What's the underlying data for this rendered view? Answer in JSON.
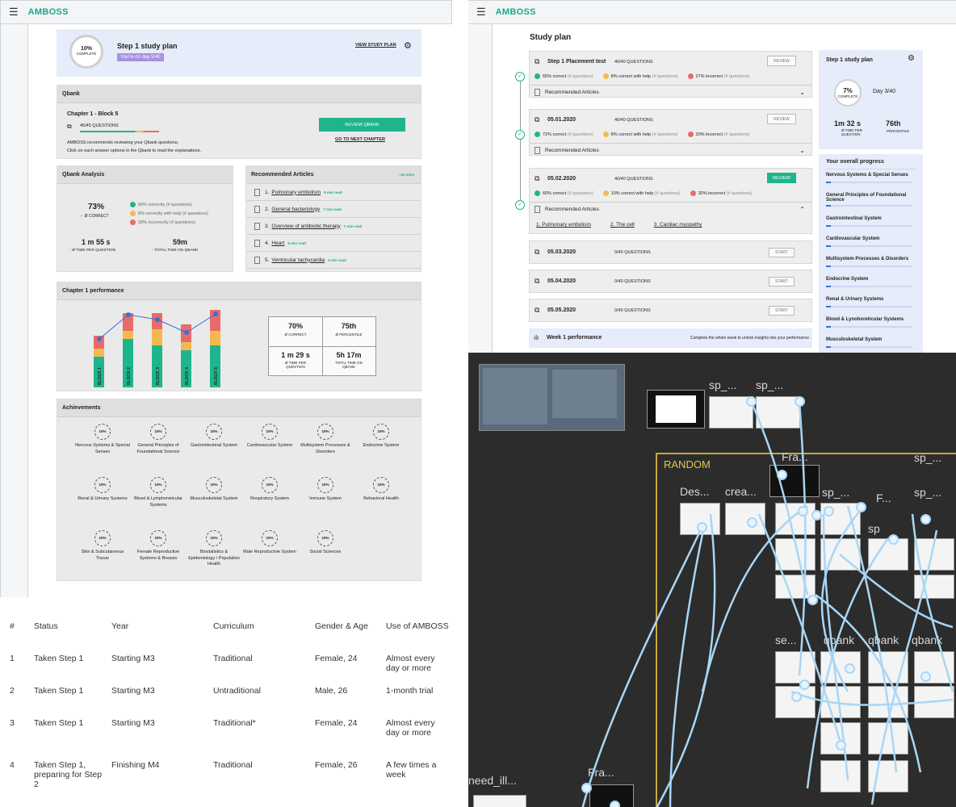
{
  "left": {
    "topbar": {
      "menu_icon": "hamburger-icon",
      "logo": "AMBOSS"
    },
    "plan": {
      "ring": "10%",
      "ring_sub": "COMPLETE",
      "title": "Step 1 study plan",
      "badge": "You're on day 5/40",
      "view": "VIEW STUDY PLAN"
    },
    "qbank": {
      "header": "Qbank",
      "chapter": "Chapter 1 - Block 5",
      "questions": "45/45 QUESTIONS",
      "note1": "AMBOSS recommends reviewing your Qbank questions.",
      "note2": "Click on each answer options in the Qbank to read the explanations.",
      "review": "REVIEW QBANK",
      "next": "GO TO NEXT CHAPTER"
    },
    "analysis": {
      "header": "Qbank Analysis",
      "pct": "73%",
      "pct_label": "Ø CORRECT",
      "l1": "65% correctly (# questions)",
      "l2": "8% correctly with help (# questions)",
      "l3": "30% incorrectly (# questions)",
      "time": "1 m 55 s",
      "time_label": "Ø TIME PER QUESTION",
      "total": "59m",
      "total_label": "TOTAL TIME ON QBANK"
    },
    "articles": {
      "header": "Recommended Articles",
      "total": "~33 mins",
      "items": [
        {
          "num": "1.",
          "title": "Pulmonary embolism",
          "min": "9 min read"
        },
        {
          "num": "2.",
          "title": "General bacteriology",
          "min": "7 min read"
        },
        {
          "num": "3.",
          "title": "Overview of antibiotic therapy",
          "min": "7 min read"
        },
        {
          "num": "4.",
          "title": "Heart",
          "min": "5 min read"
        },
        {
          "num": "5.",
          "title": "Ventricular tachycardia",
          "min": "5 min read"
        }
      ]
    },
    "performance": {
      "header": "Chapter 1 performance",
      "blocks": [
        "BLOCK 1",
        "BLOCK 2",
        "BLOCK 3",
        "BLOCK 4",
        "BLOCK 5"
      ],
      "c1": "70%",
      "c1l": "Ø CORRECT",
      "c2": "75th",
      "c2l": "Ø PERCENTILE",
      "c3": "1 m 29 s",
      "c3l": "Ø TIME PER QUESTION",
      "c4": "5h 17m",
      "c4l": "TOTAL TIME ON QBANK"
    },
    "achievements": {
      "header": "Achievements",
      "ring": "10%",
      "items": [
        "Nervous Systems & Special Senses",
        "General Principles of Foundational Science",
        "Gastrointestinal System",
        "Cardiovascular System",
        "Multisystem Processes & Disorders",
        "Endocrine System",
        "Renal & Urinary Systems",
        "Blood & Lymphoreticular Systems",
        "Musculoskeletal System",
        "Respiratory System",
        "Immune System",
        "Behavioral Health",
        "Skin & Subcutaneous Tissue",
        "Female Reproductive Systems & Breasts",
        "Biostatistics & Epidemiology / Population Health",
        "Male Reproductvie System",
        "Social Sciences"
      ]
    }
  },
  "table": {
    "headers": [
      "#",
      "Status",
      "Year",
      "Curriculum",
      "Gender & Age",
      "Use of AMBOSS"
    ],
    "rows": [
      [
        "1",
        "Taken Step 1",
        "Starting M3",
        "Traditional",
        "Female, 24",
        "Almost every day or more"
      ],
      [
        "2",
        "Taken Step 1",
        "Starting M3",
        "Untraditional",
        "Male, 26",
        "1-month trial"
      ],
      [
        "3",
        "Taken Step 1",
        "Starting M3",
        "Traditional*",
        "Female, 24",
        "Almost every day or more"
      ],
      [
        "4",
        "Taken Step 1, preparing for Step 2",
        "Finishing M4",
        "Traditional",
        "Female, 26",
        "A few times a week"
      ]
    ]
  },
  "right": {
    "topbar": {
      "logo": "AMBOSS"
    },
    "title": "Study plan",
    "entries": [
      {
        "name": "Step 1 Placement test",
        "q": "40/40 QUESTIONS",
        "btn": "REVIEW",
        "a": "65% correct",
        "b": "8% correct with help",
        "c": "27% incorrect",
        "sub": "(# questions)",
        "rec": "Recommended Articles"
      },
      {
        "name": "05.01.2020",
        "q": "40/40 QUESTIONS",
        "btn": "REVIEW",
        "a": "72% correct",
        "b": "8% correct with help",
        "c": "20% incorrect",
        "sub": "(# questions)",
        "rec": "Recommended Articles"
      },
      {
        "name": "05.02.2020",
        "q": "40/40 QUESTIONS",
        "btn": "REVIEW",
        "a": "60% correct",
        "b": "10% correct with help",
        "c": "30% incorrect",
        "sub": "(# questions)",
        "rec": "Recommended Articles",
        "links": [
          "1. Pulmonary embolism",
          "2. The cell",
          "3. Cardiac myopathy"
        ]
      }
    ],
    "upcoming": [
      {
        "name": "05.03.2020",
        "q": "0/40 QUESTIONS",
        "btn": "START"
      },
      {
        "name": "05.04.2020",
        "q": "0/40 QUESTIONS",
        "btn": "START"
      },
      {
        "name": "05.05.2020",
        "q": "0/40 QUESTIONS",
        "btn": "START"
      }
    ],
    "week": {
      "title": "Week 1 performance",
      "note": "Complete the whole week to unlock insights into your performance"
    },
    "side": {
      "title": "Step 1 study plan",
      "ring": "7%",
      "ring_sub": "COMPLETE",
      "day": "Day 3/40",
      "time": "1m 32 s",
      "time_l": "Ø TIME PER QUESTION",
      "pct": "76th",
      "pct_l": "PERCENTILE",
      "progress_title": "Your overall progress",
      "items": [
        "Nervous Systems & Special Senses",
        "General Principles of Foundational Science",
        "Gastrointestinal System",
        "Cardiovascular System",
        "Multisystem Processes & Disorders",
        "Endocrine System",
        "Renal & Urinary Systems",
        "Blood & Lynohoreticular Systems",
        "Musculoskeletal System"
      ]
    }
  },
  "figma": {
    "labels": [
      "sp_...",
      "sp_...",
      "RANDOM",
      "Fra...",
      "Des...",
      "crea...",
      "s...",
      "sp_...",
      "F...",
      "sp_...",
      "sp_...",
      "sp",
      "se...",
      "qbank",
      "qbank",
      "qbank",
      "need_ill...",
      "Fra..."
    ]
  }
}
